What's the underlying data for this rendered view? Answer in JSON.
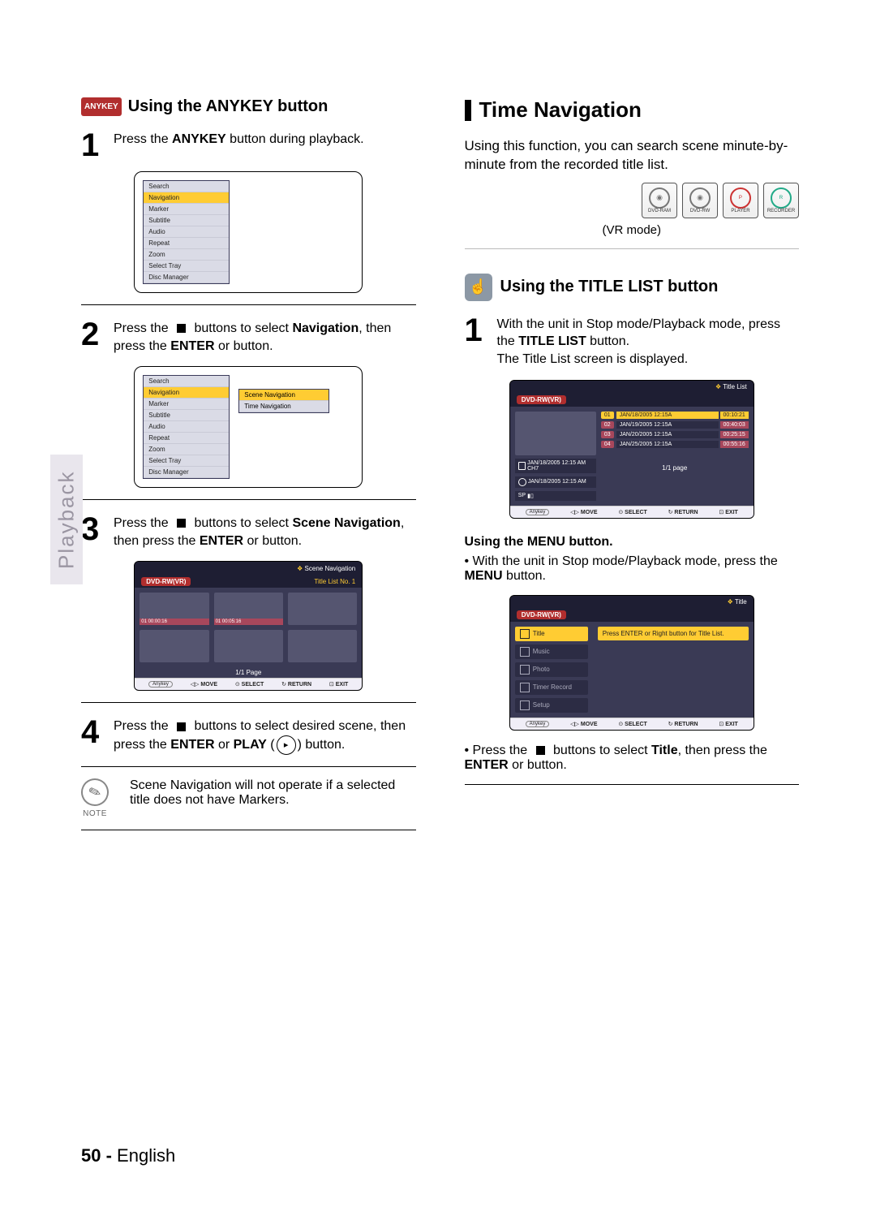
{
  "sidebarLabel": "Playback",
  "left": {
    "anykeyBadge": "ANYKEY",
    "heading": "Using the ANYKEY button",
    "step1": {
      "pre": "Press the ",
      "bold": "ANYKEY",
      "post": " button during playback."
    },
    "osdMenu": [
      "Search",
      "Navigation",
      "Marker",
      "Subtitle",
      "Audio",
      "Repeat",
      "Zoom",
      "Select Tray",
      "Disc Manager"
    ],
    "step2": {
      "a": "Press the ",
      "b": " buttons to select ",
      "bold1": "Navigation",
      "c": ", then press the ",
      "bold2": "ENTER",
      "d": " or    button."
    },
    "submenu": [
      "Scene Navigation",
      "Time Navigation"
    ],
    "step3": {
      "a": "Press the ",
      "b": " buttons to select ",
      "bold1": "Scene Navigation",
      "c": ", then press the ",
      "bold2": "ENTER",
      "d": " or    button."
    },
    "sceneNav": {
      "title": "Scene Navigation",
      "disc": "DVD-RW(VR)",
      "crumb": "Title List  No. 1",
      "thumbs": [
        "01  00:00:16",
        "01  00:05:16"
      ],
      "page": "1/1 Page",
      "foot": {
        "anykey": "Anykey",
        "move": "MOVE",
        "select": "SELECT",
        "return": "RETURN",
        "exit": "EXIT"
      }
    },
    "step4": {
      "a": "Press the ",
      "b": " buttons to select desired scene, then press the ",
      "bold1": "ENTER",
      "c": " or ",
      "bold2": "PLAY",
      "d": " (",
      "e": ") button."
    },
    "noteLabel": "NOTE",
    "noteText": "Scene Navigation will not operate if a selected title does not have Markers."
  },
  "right": {
    "title": "Time Navigation",
    "intro": "Using this function, you can search scene minute-by-minute from the recorded title list.",
    "discIcons": [
      "DVD-RAM",
      "DVD-RW",
      "PLAYER",
      "RECORDER"
    ],
    "mode": "(VR mode)",
    "sub": "Using the TITLE LIST button",
    "step1": {
      "a": "With the unit in Stop mode/Playback mode, press the ",
      "bold": "TITLE LIST",
      "b": " button.",
      "c": "The Title List screen is displayed."
    },
    "titleList": {
      "bar": "Title List",
      "disc": "DVD-RW(VR)",
      "meta1": "JAN/18/2005 12:15 AM CH7",
      "meta2": "JAN/18/2005 12:15 AM",
      "meta3": "SP",
      "rows": [
        {
          "n": "01",
          "d": "JAN/18/2005 12:15A",
          "t": "00:10:21"
        },
        {
          "n": "02",
          "d": "JAN/19/2005 12:15A",
          "t": "00:40:03"
        },
        {
          "n": "03",
          "d": "JAN/20/2005 12:15A",
          "t": "00:25:15"
        },
        {
          "n": "04",
          "d": "JAN/25/2005 12:15A",
          "t": "00:55:16"
        }
      ],
      "page": "1/1 page",
      "foot": {
        "anykey": "Anykey",
        "move": "MOVE",
        "select": "SELECT",
        "return": "RETURN",
        "exit": "EXIT"
      }
    },
    "menuHeading": "Using the MENU button.",
    "menuBullet": {
      "a": "With the unit in Stop mode/Playback mode, press the ",
      "bold": "MENU",
      "b": " button."
    },
    "titleMenu": {
      "bar": "Title",
      "disc": "DVD-RW(VR)",
      "items": [
        "Title",
        "Music",
        "Photo",
        "Timer Record",
        "Setup"
      ],
      "tip": "Press ENTER or Right button for Title List.",
      "foot": {
        "anykey": "Anykey",
        "move": "MOVE",
        "select": "SELECT",
        "return": "RETURN",
        "exit": "EXIT"
      }
    },
    "lastBullet": {
      "a": "Press the ",
      "b": " buttons to select ",
      "bold1": "Title",
      "c": ", then press the ",
      "bold2": "ENTER",
      "d": " or    button."
    }
  },
  "footer": {
    "num": "50 -",
    "lang": "English"
  }
}
